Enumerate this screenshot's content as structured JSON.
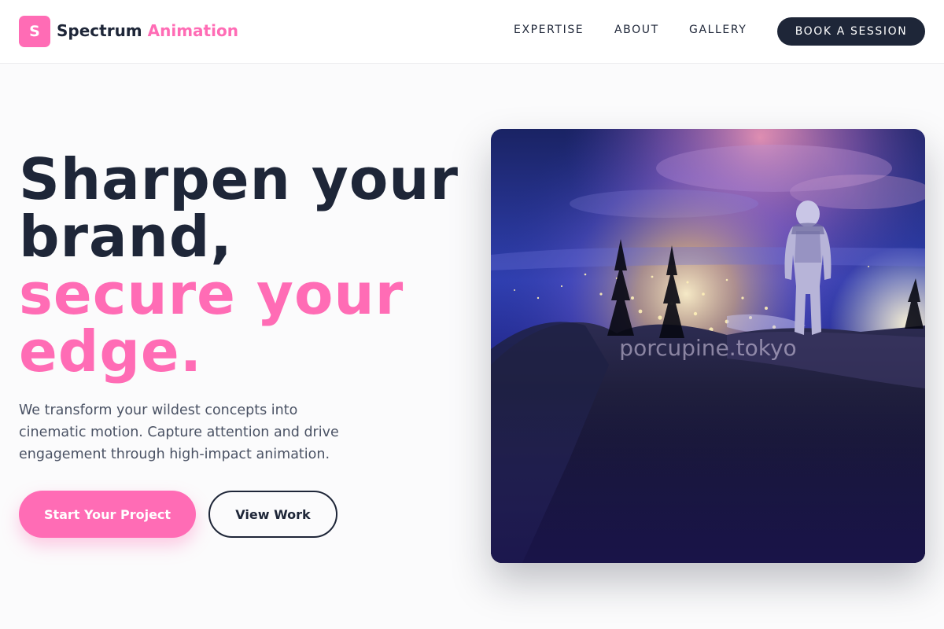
{
  "header": {
    "logo_letter": "S",
    "brand_primary": "Spectrum",
    "brand_accent": "Animation",
    "nav": [
      {
        "label": "EXPERTISE"
      },
      {
        "label": "ABOUT"
      },
      {
        "label": "GALLERY"
      }
    ],
    "cta_label": "BOOK A SESSION"
  },
  "hero": {
    "headline_line1": "Sharpen your",
    "headline_line2": "brand,",
    "headline_line3": "secure your",
    "headline_line4": "edge.",
    "lead": "We transform your wildest concepts into cinematic motion. Capture attention and drive engagement through high-impact animation.",
    "primary_button": "Start Your Project",
    "secondary_button": "View Work",
    "image_watermark": "porcupine.tokyo"
  },
  "colors": {
    "accent": "#ff6cb5",
    "dark": "#1e2638",
    "body_text": "#4a5264",
    "background": "#fbfbfc"
  }
}
